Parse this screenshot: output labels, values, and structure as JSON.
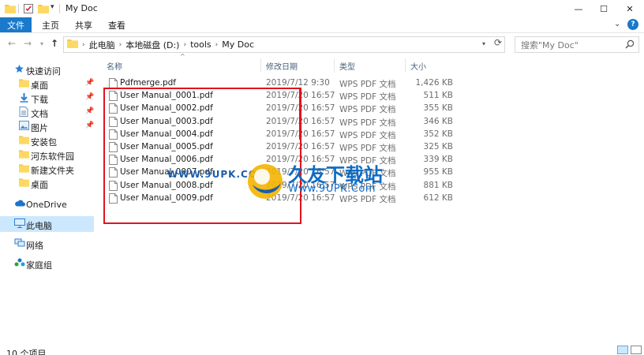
{
  "window": {
    "title": "My Doc",
    "minimize": "—",
    "maximize": "☐",
    "close": "✕"
  },
  "ribbon": {
    "tabs": [
      "文件",
      "主页",
      "共享",
      "查看"
    ],
    "expand": "⌄",
    "help": "?"
  },
  "address": {
    "crumbs": [
      "此电脑",
      "本地磁盘 (D:)",
      "tools",
      "My Doc"
    ],
    "search_placeholder": "搜索\"My Doc\""
  },
  "sidebar": {
    "items": [
      {
        "label": "快速访问",
        "icon": "star-icon"
      },
      {
        "label": "桌面",
        "icon": "folder-icon",
        "pinned": true
      },
      {
        "label": "下载",
        "icon": "download-icon",
        "pinned": true
      },
      {
        "label": "文档",
        "icon": "document-icon",
        "pinned": true
      },
      {
        "label": "图片",
        "icon": "picture-icon",
        "pinned": true
      },
      {
        "label": "安装包",
        "icon": "folder-icon"
      },
      {
        "label": "河东软件园",
        "icon": "folder-icon"
      },
      {
        "label": "新建文件夹",
        "icon": "folder-icon"
      },
      {
        "label": "桌面",
        "icon": "folder-icon"
      },
      {
        "label": "OneDrive",
        "icon": "cloud-icon"
      },
      {
        "label": "此电脑",
        "icon": "computer-icon"
      },
      {
        "label": "网络",
        "icon": "network-icon"
      },
      {
        "label": "家庭组",
        "icon": "homegroup-icon"
      }
    ]
  },
  "columns": {
    "name": "名称",
    "date": "修改日期",
    "type": "类型",
    "size": "大小"
  },
  "files": [
    {
      "name": "Pdfmerge.pdf",
      "date": "2019/7/12 9:30",
      "type": "WPS PDF 文档",
      "size": "1,426 KB"
    },
    {
      "name": "User Manual_0001.pdf",
      "date": "2019/7/20 16:57",
      "type": "WPS PDF 文档",
      "size": "511 KB"
    },
    {
      "name": "User Manual_0002.pdf",
      "date": "2019/7/20 16:57",
      "type": "WPS PDF 文档",
      "size": "355 KB"
    },
    {
      "name": "User Manual_0003.pdf",
      "date": "2019/7/20 16:57",
      "type": "WPS PDF 文档",
      "size": "346 KB"
    },
    {
      "name": "User Manual_0004.pdf",
      "date": "2019/7/20 16:57",
      "type": "WPS PDF 文档",
      "size": "352 KB"
    },
    {
      "name": "User Manual_0005.pdf",
      "date": "2019/7/20 16:57",
      "type": "WPS PDF 文档",
      "size": "325 KB"
    },
    {
      "name": "User Manual_0006.pdf",
      "date": "2019/7/20 16:57",
      "type": "WPS PDF 文档",
      "size": "339 KB"
    },
    {
      "name": "User Manual_0007.pdf",
      "date": "2019/7/20 16:57",
      "type": "WPS PDF 文档",
      "size": "955 KB"
    },
    {
      "name": "User Manual_0008.pdf",
      "date": "2019/7/20 16:57",
      "type": "WPS PDF 文档",
      "size": "881 KB"
    },
    {
      "name": "User Manual_0009.pdf",
      "date": "2019/7/20 16:57",
      "type": "WPS PDF 文档",
      "size": "612 KB"
    }
  ],
  "watermark": {
    "left_text": "WWW.9UPK.COM",
    "title": "久友下载站",
    "url": "Www.9UPK.Com"
  },
  "status": {
    "text": "10 个项目"
  },
  "colors": {
    "accent": "#1979ca",
    "selection": "#cce8ff",
    "highlight_box": "#e0141e"
  }
}
